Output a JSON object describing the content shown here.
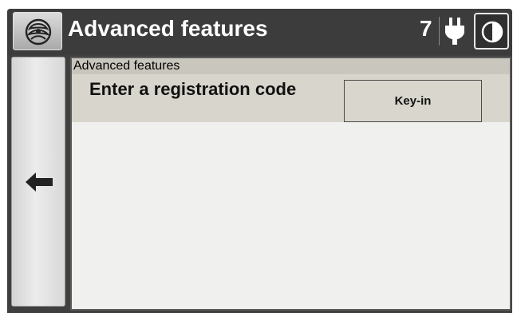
{
  "titlebar": {
    "logo_icon": "rose-logo-icon",
    "title": "Advanced features",
    "count": "7",
    "power_icon": "plug-icon",
    "contrast_icon": "contrast-icon"
  },
  "navigation": {
    "back_icon": "arrow-left-icon"
  },
  "content": {
    "section_header": "Advanced features",
    "rows": [
      {
        "label": "Enter a registration code",
        "button_label": "Key-in"
      }
    ]
  }
}
